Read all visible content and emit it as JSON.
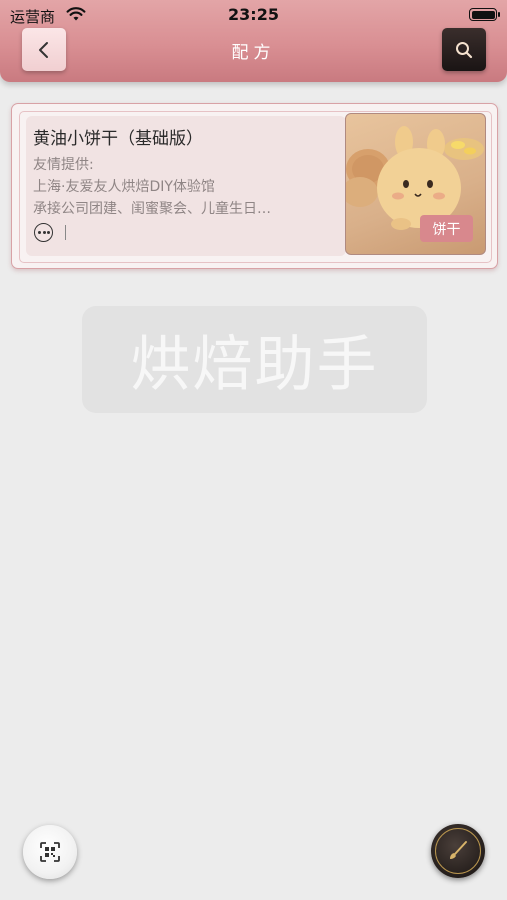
{
  "status_bar": {
    "carrier": "运营商",
    "time": "23:25"
  },
  "nav": {
    "title": "配方",
    "back_icon": "chevron-left-icon",
    "search_icon": "search-icon"
  },
  "recipe_card": {
    "title": "黄油小饼干（基础版）",
    "lines": [
      "友情提供:",
      "上海·友爱友人烘焙DIY体验馆",
      "承接公司团建、闺蜜聚会、儿童生日…"
    ],
    "more_icon": "more-icon",
    "tag": "饼干"
  },
  "watermark": "烘焙助手",
  "bottom": {
    "scan_icon": "scan-icon",
    "edit_icon": "brush-icon"
  },
  "colors": {
    "header": "#d98f93",
    "tag": "#d8888d",
    "background": "#ececec"
  }
}
